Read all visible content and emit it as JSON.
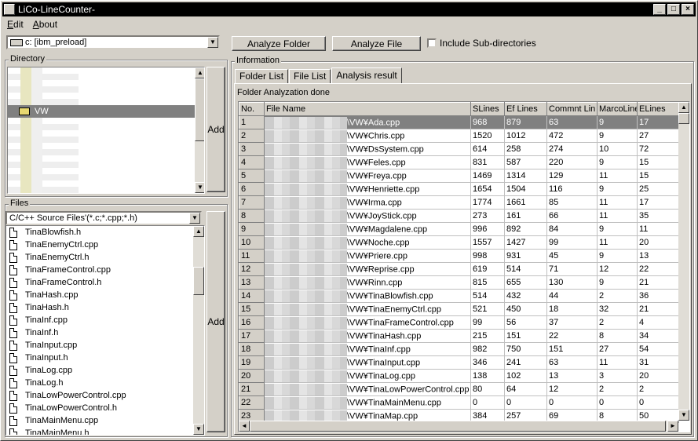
{
  "window": {
    "title": "LiCo-LineCounter-",
    "minimize": "_",
    "maximize": "□",
    "close": "×"
  },
  "menu": [
    "Edit",
    "About"
  ],
  "drive": {
    "value": "c: [ibm_preload]"
  },
  "directory": {
    "label": "Directory",
    "selected": "VW",
    "add_label": "Add"
  },
  "files": {
    "label": "Files",
    "filter": "C/C++ Source Files'(*.c;*.cpp;*.h)",
    "add_label": "Add",
    "items": [
      "TinaBlowfish.h",
      "TinaEnemyCtrl.cpp",
      "TinaEnemyCtrl.h",
      "TinaFrameControl.cpp",
      "TinaFrameControl.h",
      "TinaHash.cpp",
      "TinaHash.h",
      "TinaInf.cpp",
      "TinaInf.h",
      "TinaInput.cpp",
      "TinaInput.h",
      "TinaLog.cpp",
      "TinaLog.h",
      "TinaLowPowerControl.cpp",
      "TinaLowPowerControl.h",
      "TinaMainMenu.cpp",
      "TinaMainMenu.h"
    ]
  },
  "toolbar": {
    "analyze_folder": "Analyze Folder",
    "analyze_file": "Analyze File",
    "include_sub": "Include Sub-directories"
  },
  "information": {
    "label": "Information",
    "tabs": [
      "Folder List",
      "File List",
      "Analysis result"
    ],
    "status": "Folder Analyzation done",
    "columns": [
      "No.",
      "File Name",
      "SLines",
      "Ef Lines",
      "Commnt Lin",
      "MarcoLine",
      "ELines"
    ],
    "rows": [
      [
        "1",
        "\\VW¥Ada.cpp",
        "968",
        "879",
        "63",
        "9",
        "17"
      ],
      [
        "2",
        "\\VW¥Chris.cpp",
        "1520",
        "1012",
        "472",
        "9",
        "27"
      ],
      [
        "3",
        "\\VW¥DsSystem.cpp",
        "614",
        "258",
        "274",
        "10",
        "72"
      ],
      [
        "4",
        "\\VW¥Feles.cpp",
        "831",
        "587",
        "220",
        "9",
        "15"
      ],
      [
        "5",
        "\\VW¥Freya.cpp",
        "1469",
        "1314",
        "129",
        "11",
        "15"
      ],
      [
        "6",
        "\\VW¥Henriette.cpp",
        "1654",
        "1504",
        "116",
        "9",
        "25"
      ],
      [
        "7",
        "\\VW¥Irma.cpp",
        "1774",
        "1661",
        "85",
        "11",
        "17"
      ],
      [
        "8",
        "\\VW¥JoyStick.cpp",
        "273",
        "161",
        "66",
        "11",
        "35"
      ],
      [
        "9",
        "\\VW¥Magdalene.cpp",
        "996",
        "892",
        "84",
        "9",
        "11"
      ],
      [
        "10",
        "\\VW¥Noche.cpp",
        "1557",
        "1427",
        "99",
        "11",
        "20"
      ],
      [
        "11",
        "\\VW¥Priere.cpp",
        "998",
        "931",
        "45",
        "9",
        "13"
      ],
      [
        "12",
        "\\VW¥Reprise.cpp",
        "619",
        "514",
        "71",
        "12",
        "22"
      ],
      [
        "13",
        "\\VW¥Rinn.cpp",
        "815",
        "655",
        "130",
        "9",
        "21"
      ],
      [
        "14",
        "\\VW¥TinaBlowfish.cpp",
        "514",
        "432",
        "44",
        "2",
        "36"
      ],
      [
        "15",
        "\\VW¥TinaEnemyCtrl.cpp",
        "521",
        "450",
        "18",
        "32",
        "21"
      ],
      [
        "16",
        "\\VW¥TinaFrameControl.cpp",
        "99",
        "56",
        "37",
        "2",
        "4"
      ],
      [
        "17",
        "\\VW¥TinaHash.cpp",
        "215",
        "151",
        "22",
        "8",
        "34"
      ],
      [
        "18",
        "\\VW¥TinaInf.cpp",
        "982",
        "750",
        "151",
        "27",
        "54"
      ],
      [
        "19",
        "\\VW¥TinaInput.cpp",
        "346",
        "241",
        "63",
        "11",
        "31"
      ],
      [
        "20",
        "\\VW¥TinaLog.cpp",
        "138",
        "102",
        "13",
        "3",
        "20"
      ],
      [
        "21",
        "\\VW¥TinaLowPowerControl.cpp",
        "80",
        "64",
        "12",
        "2",
        "2"
      ],
      [
        "22",
        "\\VW¥TinaMainMenu.cpp",
        "0",
        "0",
        "0",
        "0",
        "0"
      ],
      [
        "23",
        "\\VW¥TinaMap.cpp",
        "384",
        "257",
        "69",
        "8",
        "50"
      ]
    ]
  },
  "icons": {
    "folder": "folder-open-icon",
    "file": "document-icon",
    "drive": "drive-icon"
  }
}
